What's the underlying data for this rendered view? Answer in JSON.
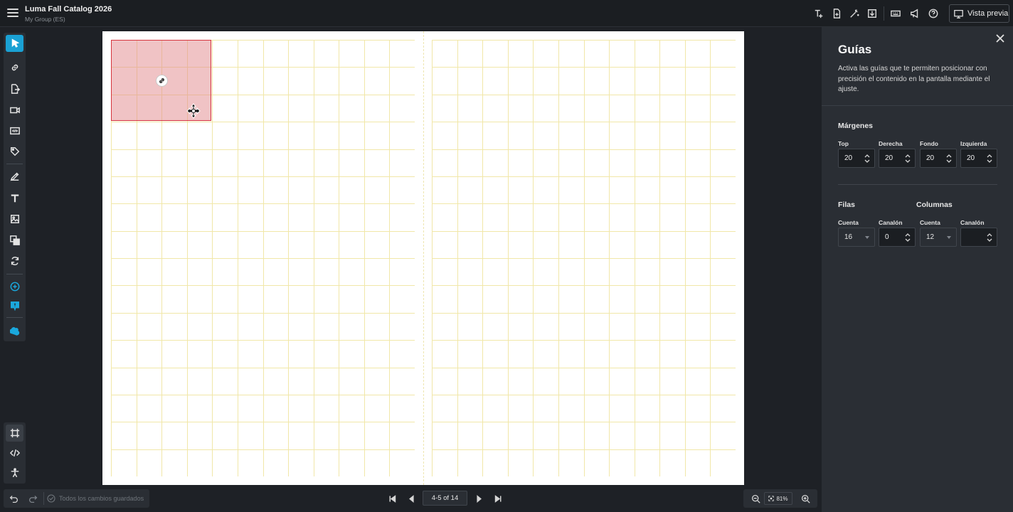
{
  "app": {
    "title": "Luma Fall Catalog 2026",
    "subtitle": "My Group (ES)",
    "preview_label": "Vista previa"
  },
  "toolbar_icons": [
    "add-text-icon",
    "new-page-icon",
    "magic-wand-icon",
    "download-icon",
    "keyboard-icon",
    "megaphone-icon",
    "help-icon"
  ],
  "left_tools": [
    "select-tool",
    "link-tool",
    "page-link-tool",
    "video-tool",
    "embed-tool",
    "tag-tool",
    "pen-tool",
    "text-tool",
    "image-tool",
    "layers-tool",
    "refresh-tool",
    "add-tool",
    "comment-tool",
    "plugin-tool"
  ],
  "guides_panel": {
    "title": "Guías",
    "description": "Activa las guías que te permiten posicionar con precisión el contenido en la pantalla mediante el ajuste.",
    "margins": {
      "title": "Márgenes",
      "top_label": "Top",
      "top_value": "20",
      "right_label": "Derecha",
      "right_value": "20",
      "bottom_label": "Fondo",
      "bottom_value": "20",
      "left_label": "Izquierda",
      "left_value": "20"
    },
    "rows": {
      "title": "Filas",
      "count_label": "Cuenta",
      "count_value": "16",
      "gutter_label": "Canalón",
      "gutter_value": "0"
    },
    "columns": {
      "title": "Columnas",
      "count_label": "Cuenta",
      "count_value": "12",
      "gutter_label": "Canalón",
      "gutter_value": ""
    }
  },
  "bottom": {
    "save_status": "Todos los cambios guardados",
    "page_indicator": "4-5 of 14",
    "zoom": "81%"
  },
  "colors": {
    "accent": "#1aa1d4",
    "selection_border": "#d6353d",
    "selection_fill": "#e28c90",
    "guide_line": "#f1e7a8"
  }
}
